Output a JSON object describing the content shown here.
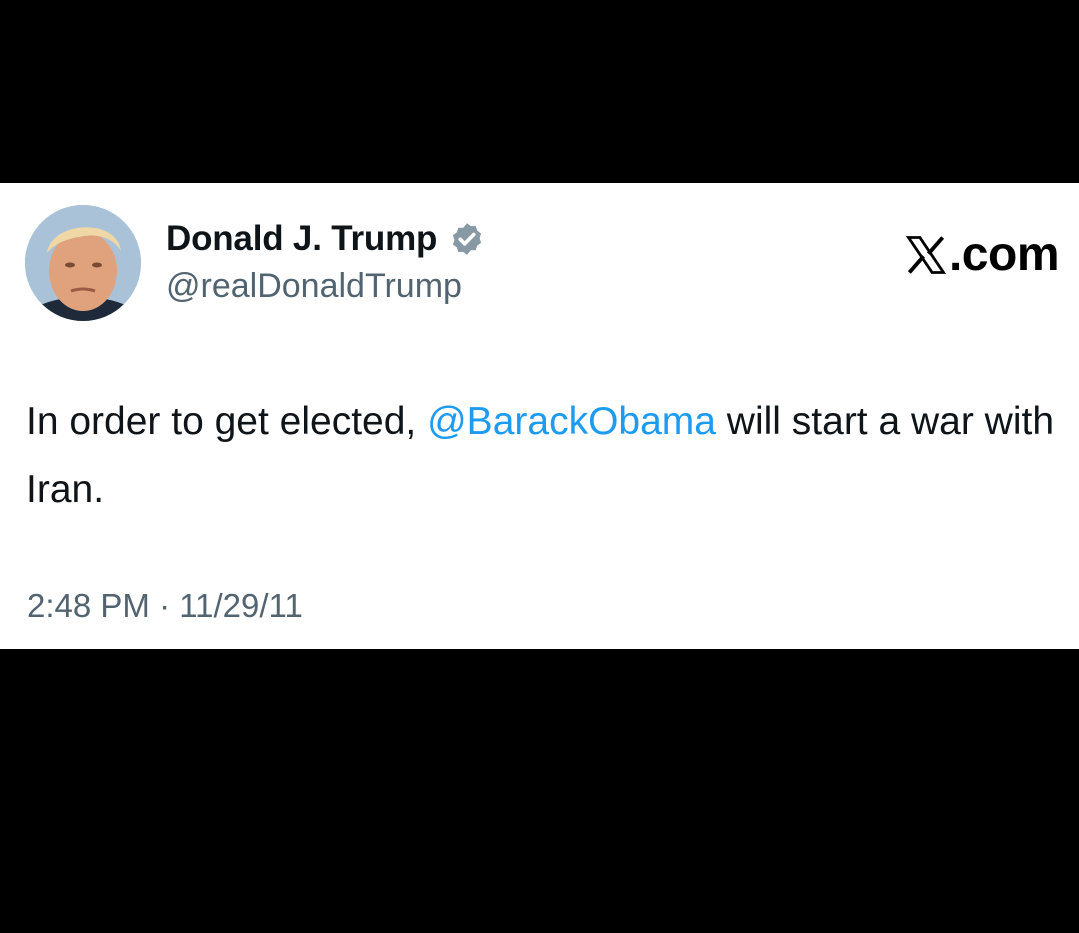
{
  "author": {
    "display_name": "Donald J. Trump",
    "handle": "@realDonaldTrump",
    "verified_icon": "verified-badge-icon",
    "badge_color": "#8899a6"
  },
  "brand": {
    "icon": "x-logo-icon",
    "label": ".com"
  },
  "tweet": {
    "text_before": "In order to get elected, ",
    "mention": "@BarackObama",
    "text_after": " will start a war with Iran.",
    "mention_color": "#1d9bf0"
  },
  "meta": {
    "time": "2:48 PM",
    "separator": " · ",
    "date": "11/29/11"
  }
}
